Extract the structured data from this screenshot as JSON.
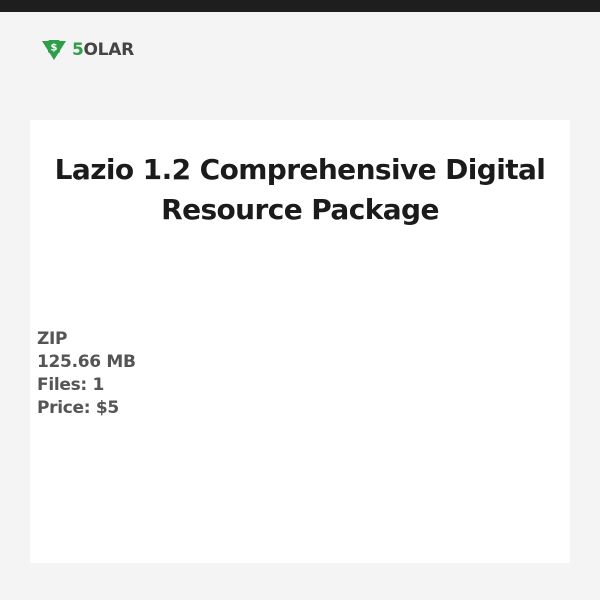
{
  "brand": {
    "logo_five": "5",
    "logo_rest": "OLAR",
    "logo_badge_symbol": "$",
    "logo_icon": "dollar-download-icon",
    "colors": {
      "green": "#2e9e4a",
      "dark": "#444444"
    }
  },
  "product": {
    "title": "Lazio 1.2 Comprehensive Digital Resource Package",
    "format": "ZIP",
    "size": "125.66 MB",
    "files": "Files: 1",
    "price": "Price: $5"
  }
}
